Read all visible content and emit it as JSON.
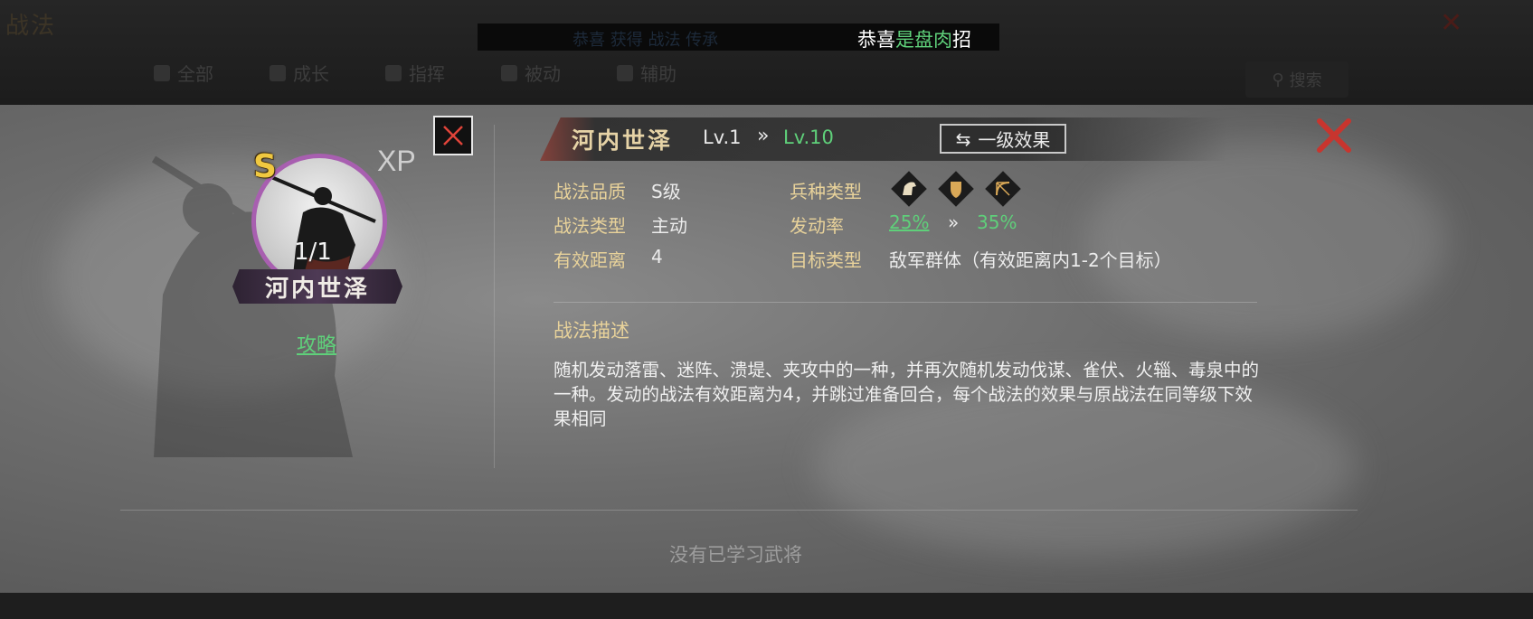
{
  "background": {
    "title": "战法",
    "tabs": [
      "全部",
      "成长",
      "指挥",
      "被动",
      "辅助"
    ],
    "search_label": "搜索"
  },
  "ticker": {
    "faded_text": "恭喜 获得 战法 传承",
    "prefix": "恭喜",
    "player_name": "是盘肉",
    "suffix": "招"
  },
  "skill_card": {
    "grade_badge": "S",
    "xp_badge": "XP",
    "count": "1/1",
    "name": "河内世泽",
    "guide_link": "攻略"
  },
  "header": {
    "skill_name": "河内世泽",
    "level_current": "Lv.1",
    "level_arrow": "»",
    "level_max": "Lv.10",
    "effect_button": "一级效果"
  },
  "attributes": {
    "quality_label": "战法品质",
    "quality_value": "S级",
    "type_label": "战法类型",
    "type_value": "主动",
    "range_label": "有效距离",
    "range_value": "4",
    "troop_label": "兵种类型",
    "troop_icons": [
      "cavalry-icon",
      "shield-icon",
      "archer-icon"
    ],
    "trigger_label": "发动率",
    "trigger_current": "25%",
    "trigger_arrow": "»",
    "trigger_max": "35%",
    "target_label": "目标类型",
    "target_value": "敌军群体（有效距离内1-2个目标）"
  },
  "description": {
    "title": "战法描述",
    "text": "随机发动落雷、迷阵、溃堤、夹攻中的一种，并再次随机发动伐谋、雀伏、火辎、毒泉中的一种。发动的战法有效距离为4，并跳过准备回合，每个战法的效果与原战法在同等级下效果相同"
  },
  "footer": {
    "no_generals": "没有已学习武将"
  },
  "colors": {
    "green": "#5fd07a",
    "gold_label": "#e8d29a",
    "red_close": "#c8352e",
    "portrait_ring": "#a85fb0"
  }
}
